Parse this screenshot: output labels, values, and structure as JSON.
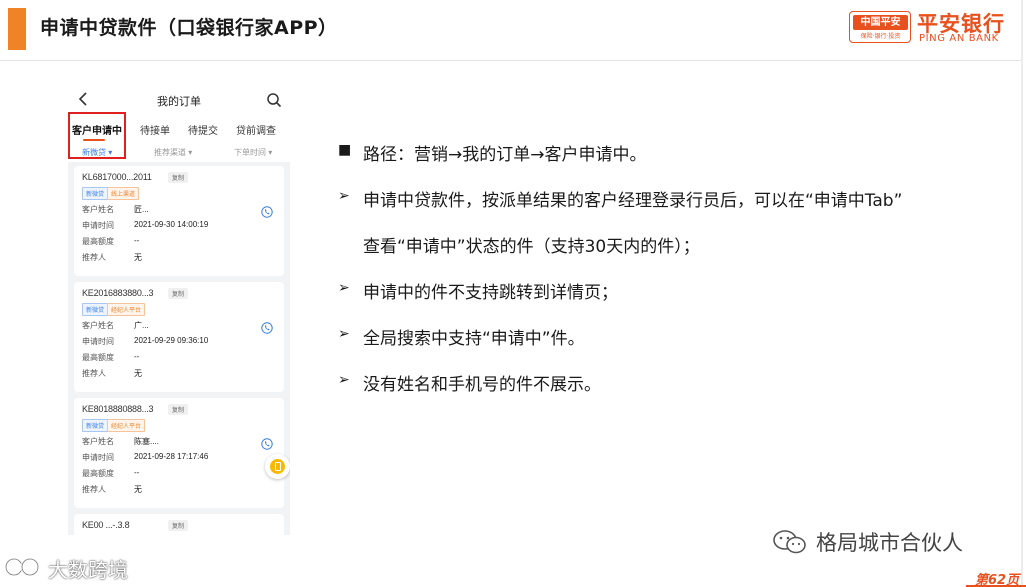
{
  "slide": {
    "title": "申请中贷款件（口袋银行家APP）",
    "page": "第62页"
  },
  "brand": {
    "box_top": "中国平安",
    "box_bottom": "保险·银行·投资",
    "name_cn": "平安银行",
    "name_en": "PING AN BANK",
    "color": "#e8501e"
  },
  "phone": {
    "title": "我的订单",
    "tabs": [
      {
        "label": "客户申请中",
        "active": true
      },
      {
        "label": "待接单"
      },
      {
        "label": "待提交"
      },
      {
        "label": "贷前调查"
      }
    ],
    "filters": [
      {
        "label": "新微贷 ▾",
        "active": true
      },
      {
        "label": "推荐渠道 ▾"
      },
      {
        "label": "下单时间 ▾"
      }
    ],
    "cards": [
      {
        "id": "KL6817000...2011",
        "copy": "复制",
        "badges": [
          {
            "text": "新微贷",
            "kind": "blue"
          },
          {
            "text": "线上渠道",
            "kind": "orange"
          }
        ],
        "fields": [
          {
            "label": "客户姓名",
            "value": "匠..."
          },
          {
            "label": "申请时间",
            "value": "2021-09-30 14:00:19"
          },
          {
            "label": "最高额度",
            "value": "--"
          },
          {
            "label": "推荐人",
            "value": "无"
          }
        ]
      },
      {
        "id": "KE2016883880...3",
        "copy": "复制",
        "badges": [
          {
            "text": "新微贷",
            "kind": "blue"
          },
          {
            "text": "经纪人平台",
            "kind": "orange"
          }
        ],
        "fields": [
          {
            "label": "客户姓名",
            "value": "广..."
          },
          {
            "label": "申请时间",
            "value": "2021-09-29 09:36:10"
          },
          {
            "label": "最高额度",
            "value": "--"
          },
          {
            "label": "推荐人",
            "value": "无"
          }
        ]
      },
      {
        "id": "KE8018880888...3",
        "copy": "复制",
        "badges": [
          {
            "text": "新微贷",
            "kind": "blue"
          },
          {
            "text": "经纪人平台",
            "kind": "orange"
          }
        ],
        "fields": [
          {
            "label": "客户姓名",
            "value": "陈塞...."
          },
          {
            "label": "申请时间",
            "value": "2021-09-28 17:17:46"
          },
          {
            "label": "最高额度",
            "value": "--"
          },
          {
            "label": "推荐人",
            "value": "无"
          }
        ]
      },
      {
        "id": "KE00 ...-.3.8",
        "copy": "复制",
        "badges": [],
        "fields": []
      }
    ]
  },
  "bullets": [
    {
      "marker": "■",
      "text": "路径：营销→我的订单→客户申请中。"
    },
    {
      "marker": "➢",
      "text": "申请中贷款件，按派单结果的客户经理登录行员后，可以在“申请中Tab”"
    },
    {
      "marker": "",
      "text": "查看“申请中”状态的件（支持30天内的件）；"
    },
    {
      "marker": "➢",
      "text": "申请中的件不支持跳转到详情页；"
    },
    {
      "marker": "➢",
      "text": "全局搜索中支持“申请中”件。"
    },
    {
      "marker": "➢",
      "text": "没有姓名和手机号的件不展示。"
    }
  ],
  "watermarks": {
    "right": "格局城市合伙人",
    "left": "大数跨境"
  }
}
